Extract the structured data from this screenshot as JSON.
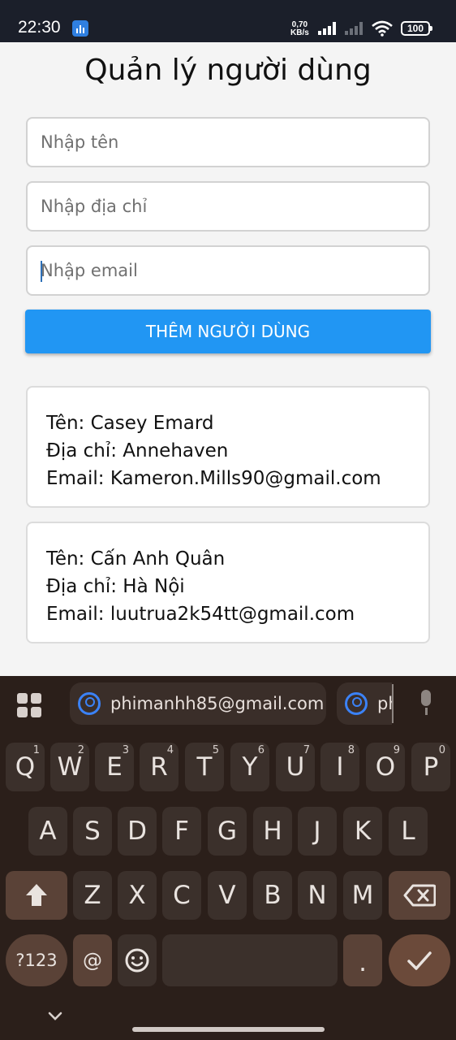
{
  "status_bar": {
    "time": "22:30",
    "net_speed_value": "0,70",
    "net_speed_unit": "KB/s",
    "battery": "100"
  },
  "app": {
    "title": "Quản lý người dùng",
    "name_placeholder": "Nhập tên",
    "address_placeholder": "Nhập địa chỉ",
    "email_placeholder": "Nhập email",
    "add_button": "THÊM NGƯỜI DÙNG",
    "users": [
      {
        "name": "Tên: Casey Emard",
        "address": "Địa chỉ: Annehaven",
        "email": "Email: Kameron.Mills90@gmail.com"
      },
      {
        "name": "Tên: Cấn Anh Quân",
        "address": "Địa chỉ: Hà Nội",
        "email": "Email: luutrua2k54tt@gmail.com"
      }
    ]
  },
  "keyboard": {
    "suggestions": [
      "phimanhh85@gmail.com",
      "ph"
    ],
    "row1": [
      {
        "k": "Q",
        "n": "1"
      },
      {
        "k": "W",
        "n": "2"
      },
      {
        "k": "E",
        "n": "3"
      },
      {
        "k": "R",
        "n": "4"
      },
      {
        "k": "T",
        "n": "5"
      },
      {
        "k": "Y",
        "n": "6"
      },
      {
        "k": "U",
        "n": "7"
      },
      {
        "k": "I",
        "n": "8"
      },
      {
        "k": "O",
        "n": "9"
      },
      {
        "k": "P",
        "n": "0"
      }
    ],
    "row2": [
      "A",
      "S",
      "D",
      "F",
      "G",
      "H",
      "J",
      "K",
      "L"
    ],
    "row3": [
      "Z",
      "X",
      "C",
      "V",
      "B",
      "N",
      "M"
    ],
    "symbols_key": "?123",
    "at_key": "@",
    "period_key": ".",
    "icons": [
      "apps-grid-icon",
      "person-icon",
      "mic-icon",
      "shift-icon",
      "backspace-icon",
      "emoji-icon",
      "check-icon",
      "chevron-down-icon"
    ],
    "colors": {
      "background": "#2b1f1a",
      "key": "#3b302b",
      "modifier": "#5a4237",
      "accent": "#6b4a3a",
      "contact_icon": "#3b82f6"
    }
  }
}
